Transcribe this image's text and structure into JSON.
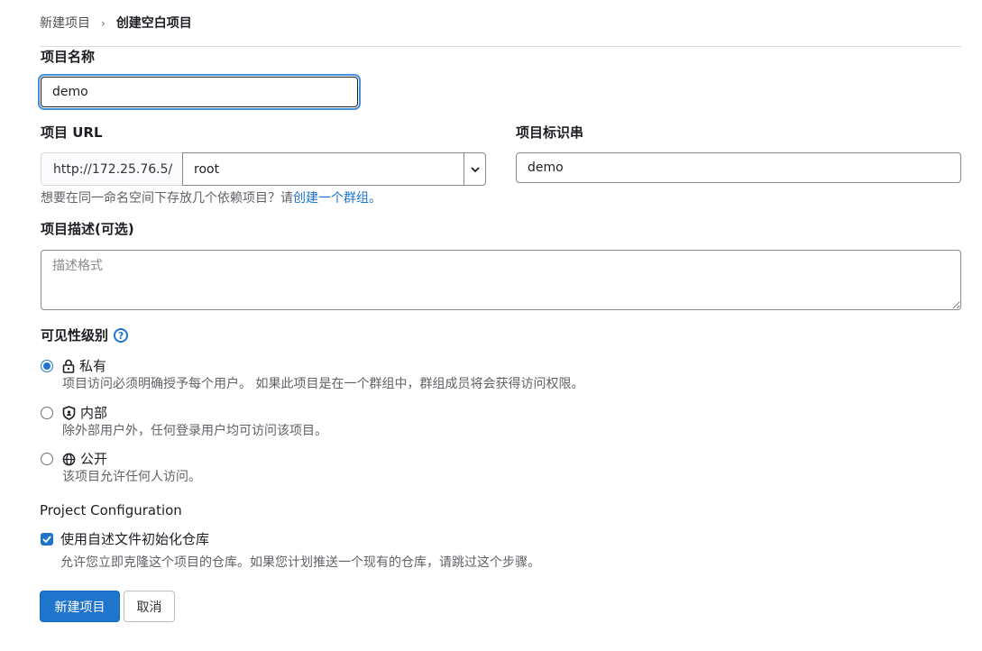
{
  "breadcrumb": {
    "parent": "新建项目",
    "separator": "›",
    "current": "创建空白项目"
  },
  "project_name": {
    "label": "项目名称",
    "value": "demo"
  },
  "project_url": {
    "label": "项目 URL",
    "prefix": "http://172.25.76.5/",
    "namespace": "root"
  },
  "project_slug": {
    "label": "项目标识串",
    "value": "demo"
  },
  "group_hint": {
    "text": "想要在同一命名空间下存放几个依赖项目？请",
    "link": "创建一个群组。"
  },
  "description": {
    "label": "项目描述(可选)",
    "placeholder": "描述格式"
  },
  "visibility": {
    "label": "可见性级别",
    "help_glyph": "?",
    "options": [
      {
        "icon": "lock-icon",
        "title": "私有",
        "desc": "项目访问必须明确授予每个用户。 如果此项目是在一个群组中，群组成员将会获得访问权限。",
        "checked": true
      },
      {
        "icon": "shield-icon",
        "title": "内部",
        "desc": "除外部用户外，任何登录用户均可访问该项目。",
        "checked": false
      },
      {
        "icon": "globe-icon",
        "title": "公开",
        "desc": "该项目允许任何人访问。",
        "checked": false
      }
    ]
  },
  "config": {
    "heading": "Project Configuration",
    "readme_label": "使用自述文件初始化仓库",
    "readme_checked": true,
    "readme_help": "允许您立即克隆这个项目的仓库。如果您计划推送一个现有的仓库，请跳过这个步骤。"
  },
  "actions": {
    "create": "新建项目",
    "cancel": "取消"
  },
  "colors": {
    "primary": "#1f75cb",
    "focus_ring": "#428fdc"
  }
}
